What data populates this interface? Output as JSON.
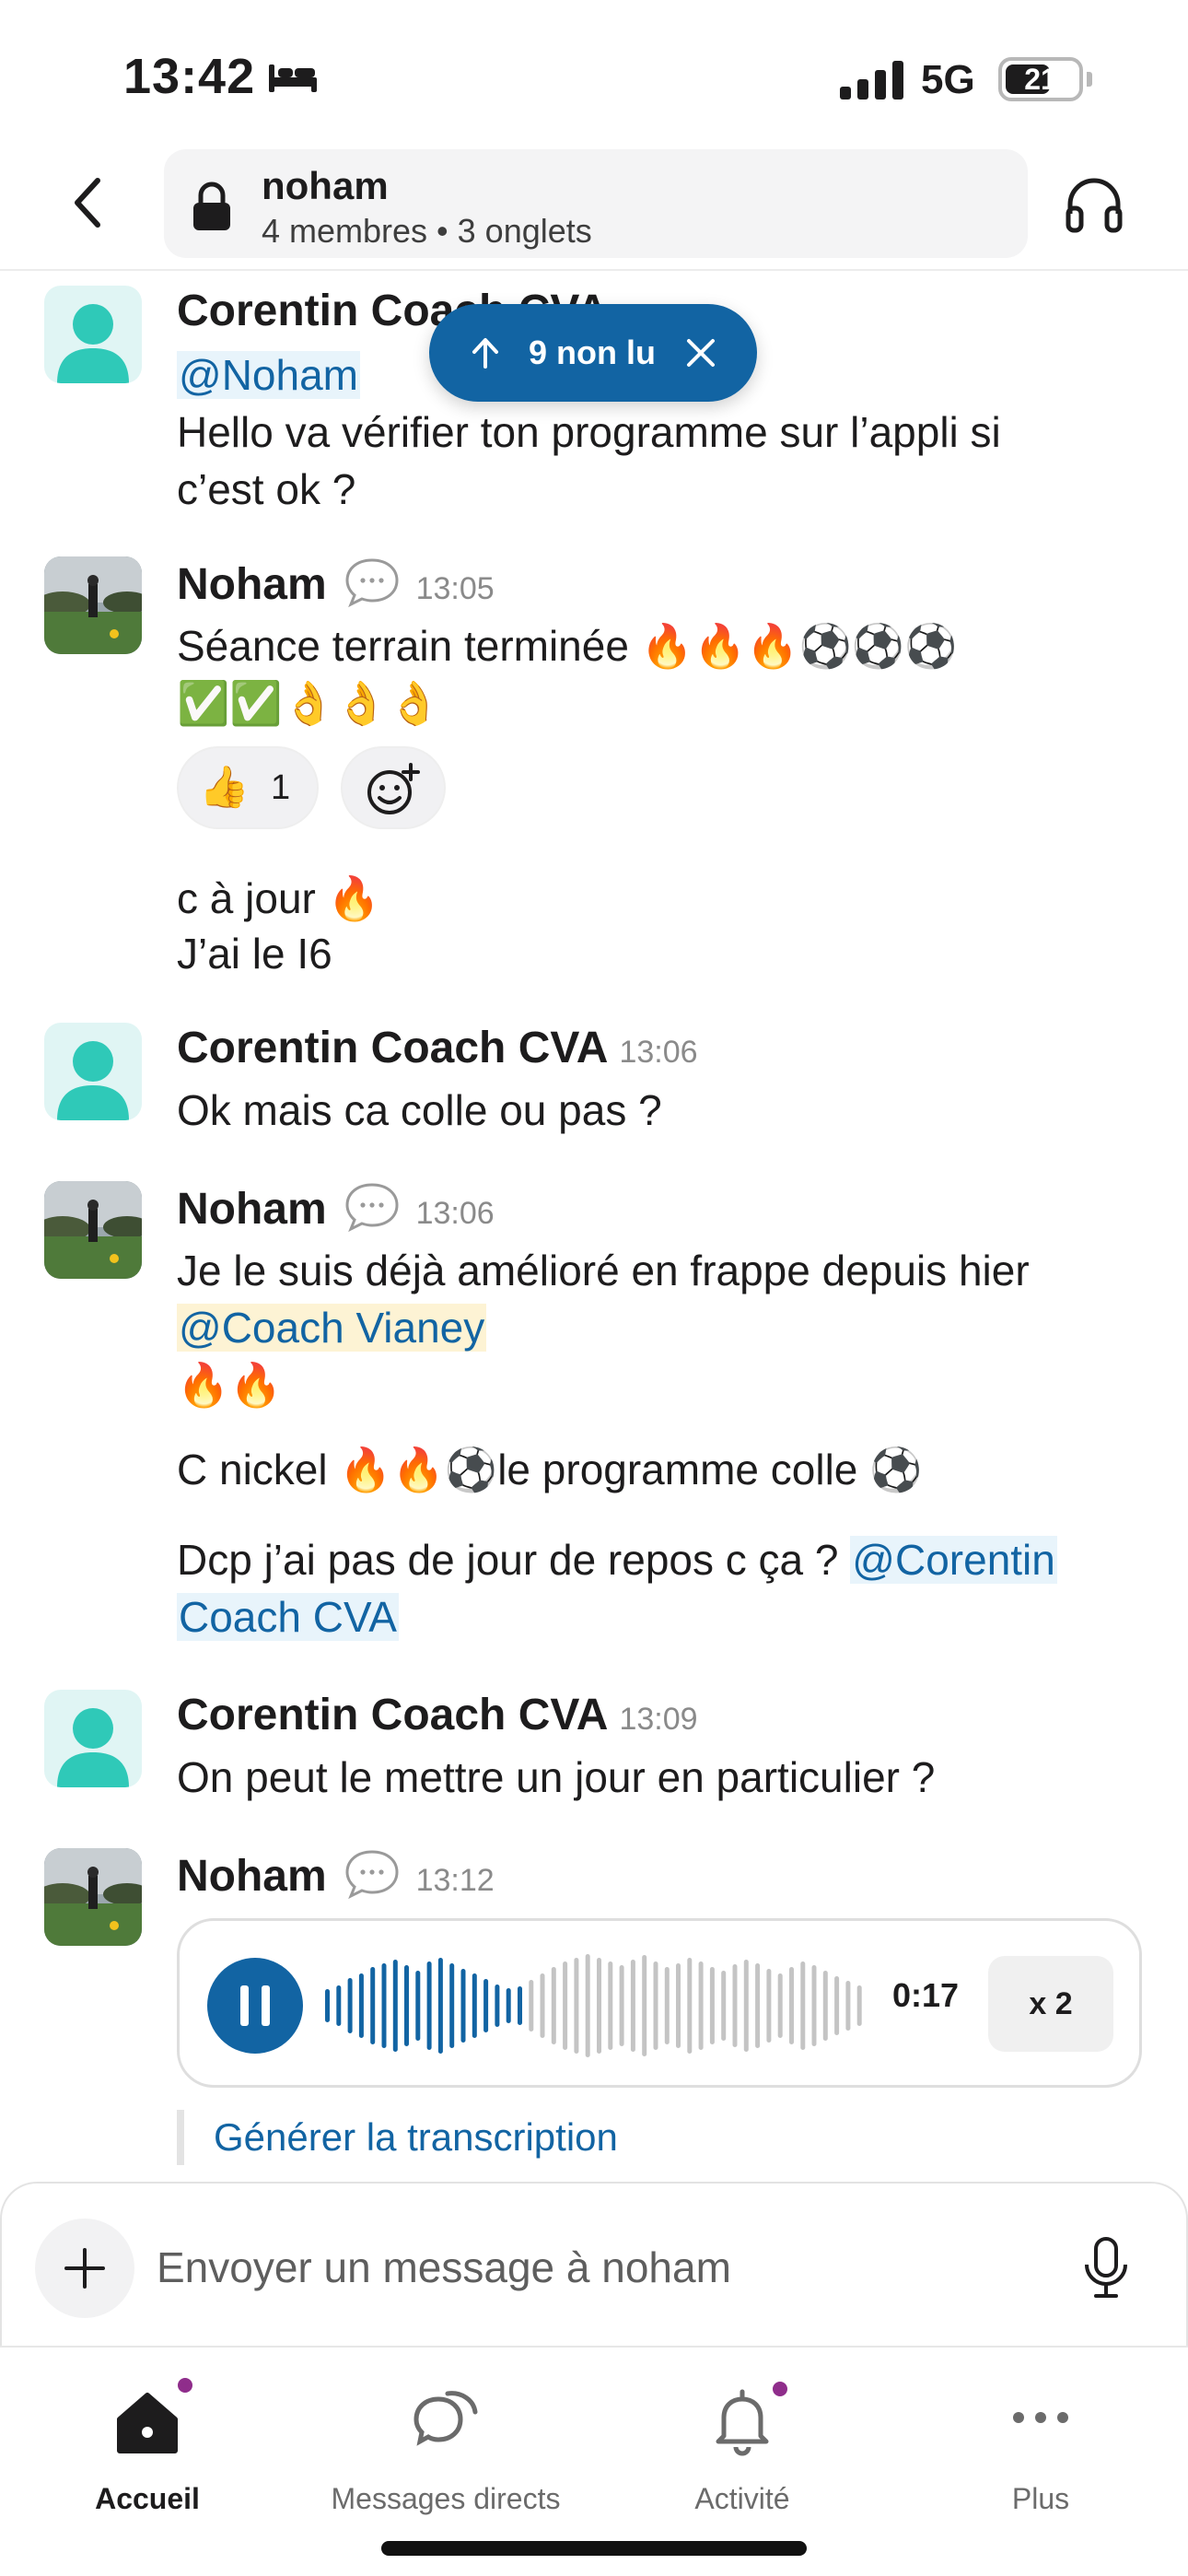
{
  "status_bar": {
    "time": "13:42",
    "network": "5G",
    "battery": "21"
  },
  "header": {
    "channel_name": "noham",
    "channel_meta": "4 membres • 3 onglets"
  },
  "unread_banner": {
    "label": "9 non lu"
  },
  "messages": [
    {
      "sender": "Corentin Coach CVA",
      "time": "",
      "lines": [
        "@Noham",
        "Hello va vérifier ton programme sur l’appli si",
        "c’est ok ?"
      ]
    },
    {
      "sender": "Noham",
      "time": "13:05",
      "lines": [
        "Séance terrain terminée 🔥🔥🔥⚽⚽⚽",
        "✅✅👌👌👌"
      ],
      "reaction": {
        "emoji": "👍",
        "count": "1"
      },
      "followups": [
        "c à jour 🔥",
        "J’ai le I6"
      ]
    },
    {
      "sender": "Corentin Coach CVA",
      "time": "13:06",
      "lines": [
        "Ok mais ca colle ou pas ?"
      ]
    },
    {
      "sender": "Noham",
      "time": "13:06",
      "lines": [
        "Je le suis déjà amélioré en frappe depuis hier",
        "@Coach Vianey",
        "🔥🔥",
        "C nickel 🔥🔥⚽le programme colle ⚽",
        "Dcp j’ai pas de jour de repos c ça ?",
        "@Corentin",
        "Coach CVA"
      ]
    },
    {
      "sender": "Corentin Coach CVA",
      "time": "13:09",
      "lines": [
        "On peut le mettre un jour en particulier ?"
      ]
    },
    {
      "sender": "Noham",
      "time": "13:12",
      "voice": {
        "duration": "0:17",
        "speed": "x 2",
        "progress": 0.36
      },
      "transcript_label": "Générer la transcription"
    }
  ],
  "composer": {
    "placeholder": "Envoyer un message à noham"
  },
  "tabs": [
    {
      "label": "Accueil",
      "active": true
    },
    {
      "label": "Messages directs",
      "active": false
    },
    {
      "label": "Activité",
      "active": false
    },
    {
      "label": "Plus",
      "active": false
    }
  ],
  "colors": {
    "accent": "#1264a3",
    "avatar_teal": "#2fc9b8",
    "badge": "#8f2d8b"
  }
}
